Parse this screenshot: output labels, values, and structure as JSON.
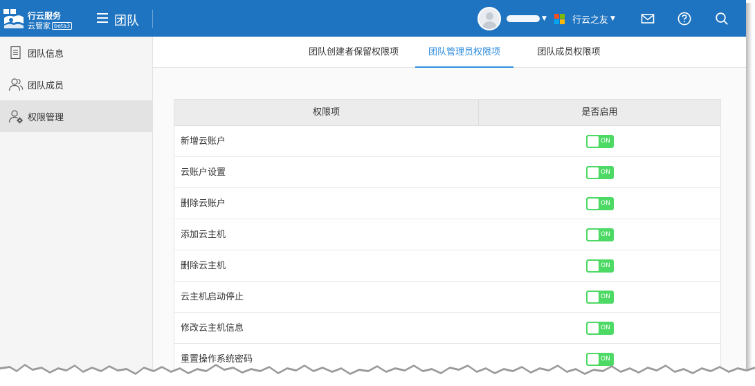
{
  "header": {
    "logo": {
      "line1": "行云服务",
      "line2": "云管家",
      "badge": "beta3"
    },
    "title": "团队",
    "org_name": "行云之友",
    "icons": [
      "menu-icon",
      "mail-icon",
      "help-icon",
      "search-icon"
    ],
    "colors": {
      "bar": "#1f74c1"
    }
  },
  "sidebar": {
    "items": [
      {
        "label": "团队信息",
        "icon": "document-icon",
        "active": false
      },
      {
        "label": "团队成员",
        "icon": "users-icon",
        "active": false
      },
      {
        "label": "权限管理",
        "icon": "user-gear-icon",
        "active": true
      }
    ]
  },
  "tabs": [
    {
      "label": "团队创建者保留权限项",
      "active": false
    },
    {
      "label": "团队管理员权限项",
      "active": true
    },
    {
      "label": "团队成员权限项",
      "active": false
    }
  ],
  "table": {
    "headers": [
      "权限项",
      "是否启用"
    ],
    "toggle_on_label": "ON",
    "rows": [
      {
        "name": "新增云账户",
        "enabled": true
      },
      {
        "name": "云账户设置",
        "enabled": true
      },
      {
        "name": "删除云账户",
        "enabled": true
      },
      {
        "name": "添加云主机",
        "enabled": true
      },
      {
        "name": "删除云主机",
        "enabled": true
      },
      {
        "name": "云主机启动停止",
        "enabled": true
      },
      {
        "name": "修改云主机信息",
        "enabled": true
      },
      {
        "name": "重置操作系统密码",
        "enabled": true
      }
    ]
  },
  "colors": {
    "accent": "#2f8ee0",
    "toggle_on": "#4cd964"
  }
}
